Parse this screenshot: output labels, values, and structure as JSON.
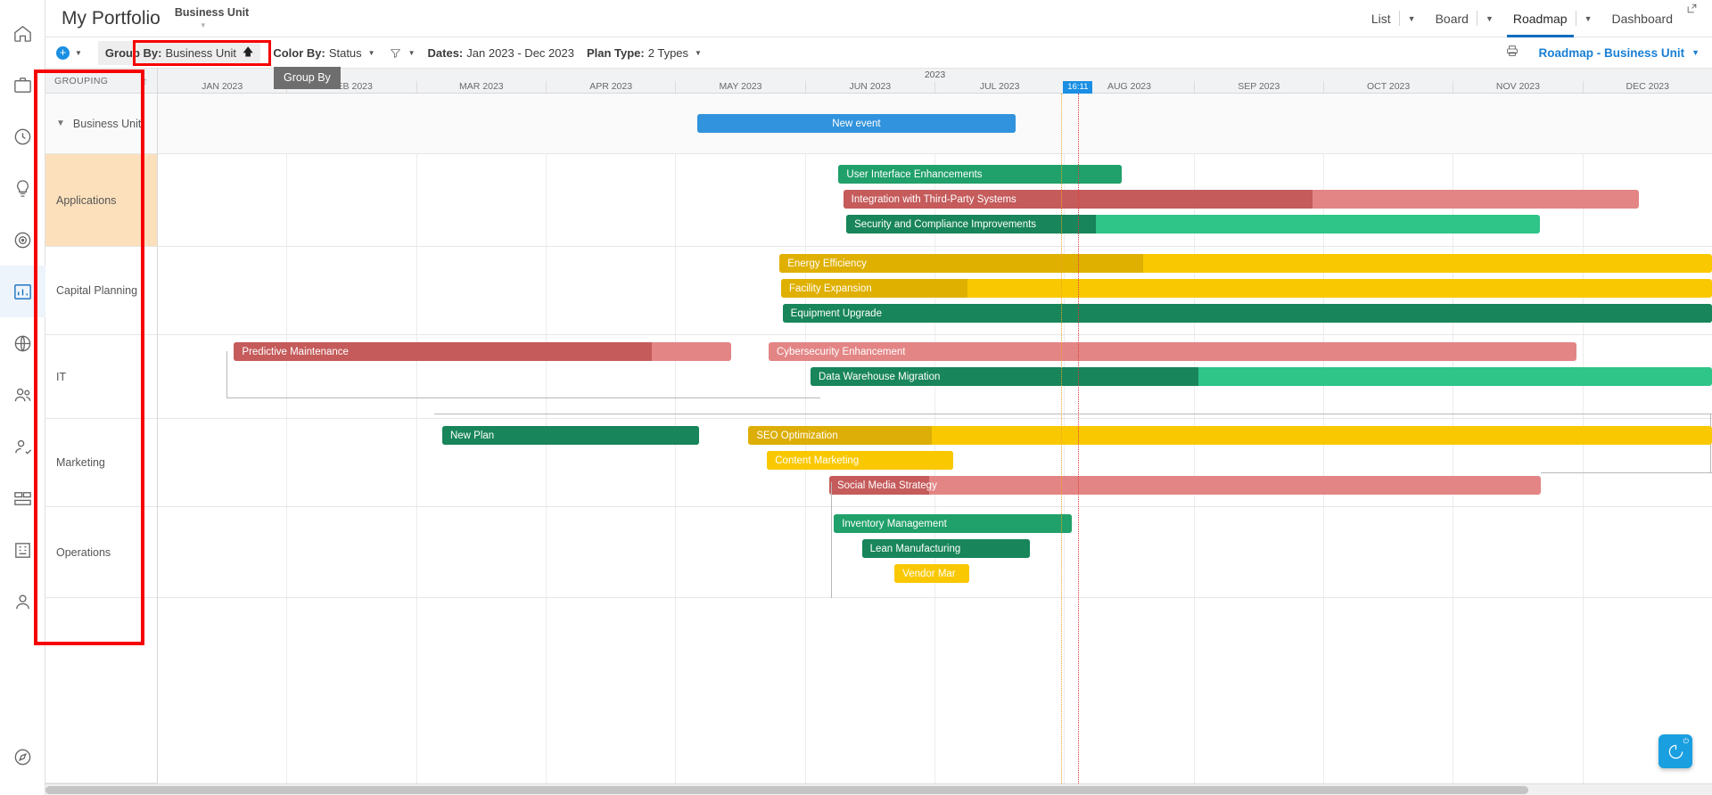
{
  "rail": {
    "items": [
      {
        "name": "home-icon",
        "label": "Home"
      },
      {
        "name": "briefcase-icon",
        "label": "Portfolios"
      },
      {
        "name": "clock-icon",
        "label": "Timesheets"
      },
      {
        "name": "lightbulb-icon",
        "label": "Ideas"
      },
      {
        "name": "target-icon",
        "label": "Goals"
      },
      {
        "name": "chart-icon",
        "label": "Reports"
      },
      {
        "name": "globe-icon",
        "label": "Global"
      },
      {
        "name": "people-icon",
        "label": "Resources"
      },
      {
        "name": "user-check-icon",
        "label": "Approvals"
      },
      {
        "name": "layers-icon",
        "label": "Programs"
      },
      {
        "name": "building-icon",
        "label": "Organization"
      },
      {
        "name": "person-icon",
        "label": "Profile"
      }
    ],
    "bottom": {
      "name": "compass-icon",
      "label": "Explore"
    }
  },
  "header": {
    "title": "My Portfolio",
    "subtitle": "Business Unit",
    "tabs": [
      {
        "label": "List",
        "active": false,
        "has_caret": true
      },
      {
        "label": "Board",
        "active": false,
        "has_caret": true
      },
      {
        "label": "Roadmap",
        "active": true,
        "has_caret": true
      },
      {
        "label": "Dashboard",
        "active": false,
        "has_caret": false
      }
    ],
    "expand_icon": "expand-icon"
  },
  "toolbar": {
    "add_label": "+",
    "group_by_key": "Group By:",
    "group_by_value": "Business Unit",
    "color_by_key": "Color By:",
    "color_by_value": "Status",
    "filter_icon": "funnel-icon",
    "dates_key": "Dates:",
    "dates_value": "Jan 2023 - Dec 2023",
    "plan_type_key": "Plan Type:",
    "plan_type_value": "2 Types",
    "print_icon": "print-icon",
    "roadmap_selector": "Roadmap - Business Unit",
    "tooltip": "Group By"
  },
  "grouping": {
    "header": "GROUPING",
    "sort_icon": "sort-ascending-icon",
    "rows": [
      {
        "label": "Business Unit",
        "type": "parent"
      },
      {
        "label": "Applications",
        "type": "group"
      },
      {
        "label": "Capital Planning",
        "type": "group"
      },
      {
        "label": "IT",
        "type": "group"
      },
      {
        "label": "Marketing",
        "type": "group"
      },
      {
        "label": "Operations",
        "type": "group"
      }
    ]
  },
  "timeline": {
    "year": "2023",
    "months": [
      "JAN 2023",
      "FEB 2023",
      "MAR 2023",
      "APR 2023",
      "MAY 2023",
      "JUN 2023",
      "JUL 2023",
      "AUG 2023",
      "SEP 2023",
      "OCT 2023",
      "NOV 2023",
      "DEC 2023"
    ],
    "time_badge": "16:11"
  },
  "colors": {
    "green": "#20a06a",
    "green_dark": "#18855a",
    "red": "#dd7070",
    "red_dark": "#c55b5b",
    "yellow": "#f7c512",
    "yellow_dark": "#dcae07",
    "blue": "#3193dd",
    "applications_highlight": "#fce0bc",
    "accent": "#0f6cbd"
  },
  "chart_data": {
    "type": "bar",
    "title": "Roadmap - Business Unit",
    "xlabel": "2023",
    "categories": [
      "JAN 2023",
      "FEB 2023",
      "MAR 2023",
      "APR 2023",
      "MAY 2023",
      "JUN 2023",
      "JUL 2023",
      "AUG 2023",
      "SEP 2023",
      "OCT 2023",
      "NOV 2023",
      "DEC 2023"
    ],
    "groups": [
      {
        "name": "Business Unit",
        "tasks": [
          {
            "label": "New event",
            "start_pct": 34.7,
            "width_pct": 20.5,
            "progress_pct": 100,
            "color": "blue",
            "centered": true
          }
        ]
      },
      {
        "name": "Applications",
        "tasks": [
          {
            "label": "User Interface Enhancements",
            "start_pct": 43.8,
            "width_pct": 18.2,
            "progress_pct": 100,
            "color": "green"
          },
          {
            "label": "Integration with Third-Party Systems",
            "start_pct": 44.1,
            "width_pct": 51.2,
            "progress_pct": 59,
            "color": "red"
          },
          {
            "label": "Security and Compliance Improvements",
            "start_pct": 44.3,
            "width_pct": 44.6,
            "progress_pct": 36,
            "color": "green"
          }
        ]
      },
      {
        "name": "Capital Planning",
        "tasks": [
          {
            "label": "Energy Efficiency",
            "start_pct": 40.0,
            "width_pct": 60.0,
            "progress_pct": 39,
            "color": "yellow"
          },
          {
            "label": "Facility Expansion",
            "start_pct": 40.1,
            "width_pct": 59.9,
            "progress_pct": 20,
            "color": "yellow"
          },
          {
            "label": "Equipment Upgrade",
            "start_pct": 40.2,
            "width_pct": 59.8,
            "progress_pct": 100,
            "color": "green"
          }
        ]
      },
      {
        "name": "IT",
        "tasks": [
          {
            "label": "Predictive Maintenance",
            "start_pct": 4.9,
            "width_pct": 32.0,
            "progress_pct": 84,
            "color": "red"
          },
          {
            "label": "Cybersecurity Enhancement",
            "start_pct": 39.3,
            "width_pct": 52.0,
            "progress_pct": 0,
            "color": "red"
          },
          {
            "label": "Data Warehouse Migration",
            "start_pct": 42.0,
            "width_pct": 58.0,
            "progress_pct": 43,
            "color": "green"
          }
        ]
      },
      {
        "name": "Marketing",
        "tasks": [
          {
            "label": "New Plan",
            "start_pct": 18.3,
            "width_pct": 16.5,
            "progress_pct": 100,
            "color": "green"
          },
          {
            "label": "SEO Optimization",
            "start_pct": 38.0,
            "width_pct": 62.0,
            "progress_pct": 19,
            "color": "yellow"
          },
          {
            "label": "Content Marketing",
            "start_pct": 39.2,
            "width_pct": 12.0,
            "progress_pct": 100,
            "color": "yellow"
          },
          {
            "label": "Social Media Strategy",
            "start_pct": 43.2,
            "width_pct": 45.8,
            "progress_pct": 14,
            "color": "red"
          }
        ]
      },
      {
        "name": "Operations",
        "tasks": [
          {
            "label": "Inventory Management",
            "start_pct": 43.5,
            "width_pct": 15.3,
            "progress_pct": 100,
            "color": "green"
          },
          {
            "label": "Lean Manufacturing",
            "start_pct": 45.3,
            "width_pct": 10.8,
            "progress_pct": 100,
            "color": "green"
          },
          {
            "label": "Vendor Mar",
            "start_pct": 47.4,
            "width_pct": 4.8,
            "progress_pct": 100,
            "color": "yellow"
          }
        ]
      }
    ],
    "markers": [
      {
        "name": "today-line-orange",
        "position_pct": 58.1,
        "color": "#f0a22a"
      },
      {
        "name": "current-time-line-red",
        "position_pct": 59.2,
        "color": "#e23b3b"
      }
    ]
  }
}
